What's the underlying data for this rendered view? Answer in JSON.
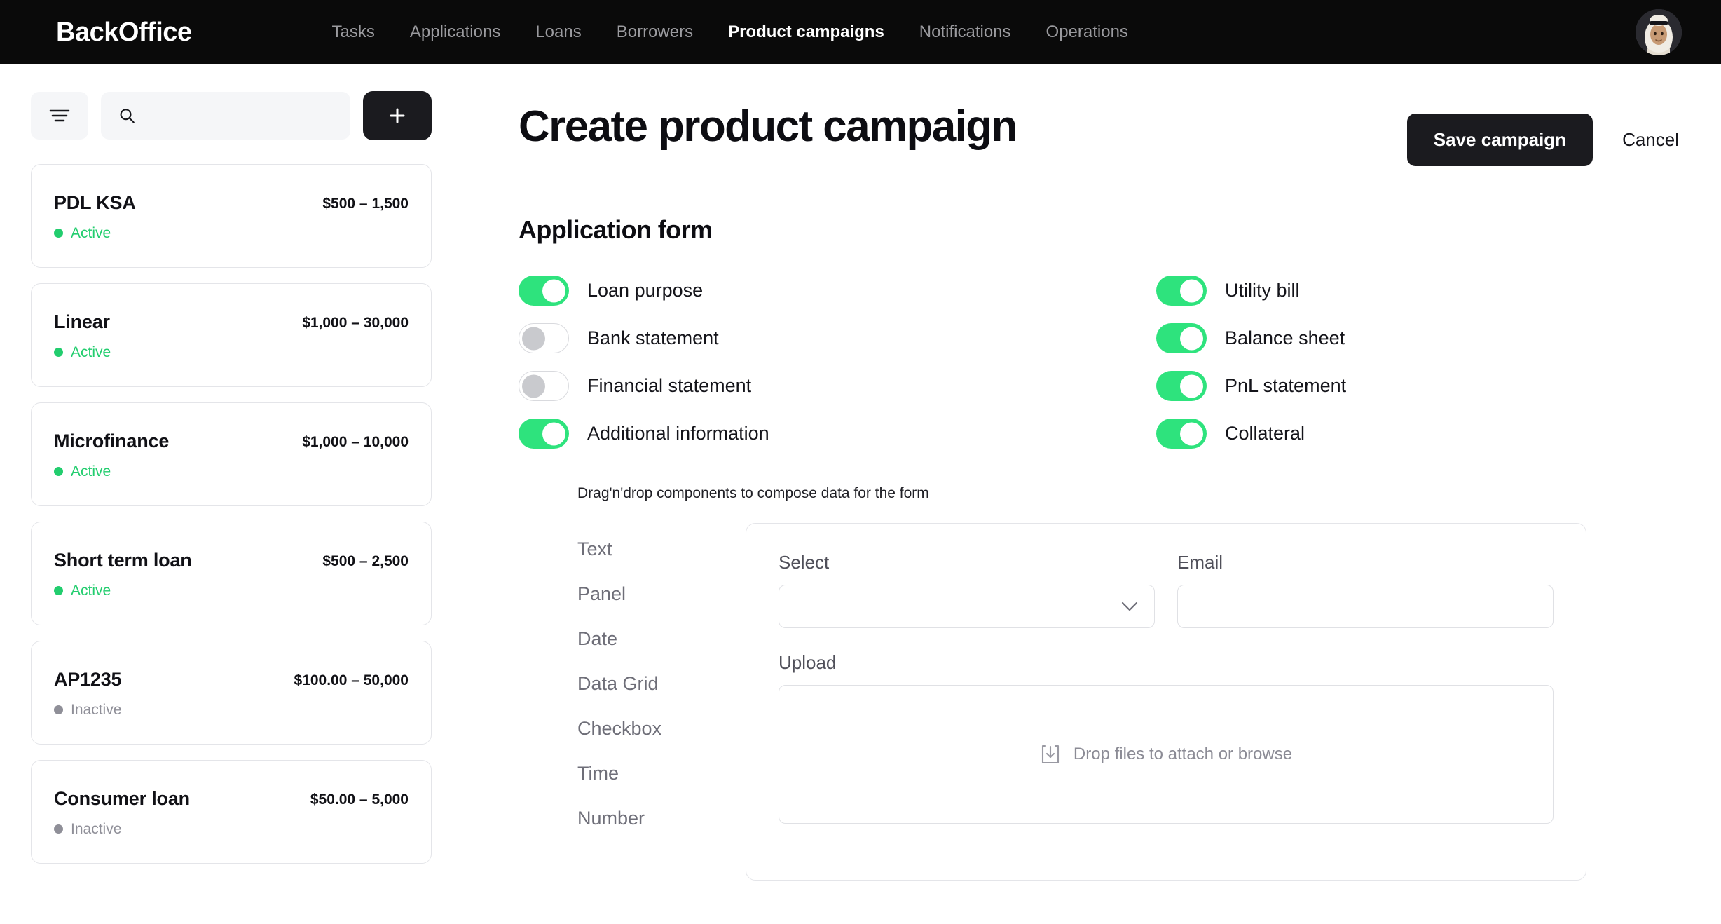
{
  "nav": {
    "brand": "BackOffice",
    "items": [
      {
        "label": "Tasks",
        "active": false
      },
      {
        "label": "Applications",
        "active": false
      },
      {
        "label": "Loans",
        "active": false
      },
      {
        "label": "Borrowers",
        "active": false
      },
      {
        "label": "Product campaigns",
        "active": true
      },
      {
        "label": "Notifications",
        "active": false
      },
      {
        "label": "Operations",
        "active": false
      }
    ],
    "avatar_icon": "user-avatar-photo"
  },
  "sidebar": {
    "filter_icon": "filter-icon",
    "search_icon": "search-icon",
    "search_value": "",
    "search_placeholder": "",
    "add_icon": "plus-icon",
    "campaigns": [
      {
        "name": "PDL KSA",
        "amount": "$500 – 1,500",
        "status": "Active",
        "state": "active"
      },
      {
        "name": "Linear",
        "amount": "$1,000 – 30,000",
        "status": "Active",
        "state": "active"
      },
      {
        "name": "Microfinance",
        "amount": "$1,000 – 10,000",
        "status": "Active",
        "state": "active"
      },
      {
        "name": "Short term loan",
        "amount": "$500 – 2,500",
        "status": "Active",
        "state": "active"
      },
      {
        "name": "AP1235",
        "amount": "$100.00 – 50,000",
        "status": "Inactive",
        "state": "inactive"
      },
      {
        "name": "Consumer loan",
        "amount": "$50.00 – 5,000",
        "status": "Inactive",
        "state": "inactive"
      }
    ]
  },
  "main": {
    "title": "Create product campaign",
    "save_label": "Save campaign",
    "cancel_label": "Cancel",
    "section_title": "Application form",
    "toggles": [
      {
        "label": "Loan purpose",
        "on": true
      },
      {
        "label": "Utility bill",
        "on": true
      },
      {
        "label": "Bank statement",
        "on": false
      },
      {
        "label": "Balance sheet",
        "on": true
      },
      {
        "label": "Financial statement",
        "on": false
      },
      {
        "label": "PnL statement",
        "on": true
      },
      {
        "label": "Additional information",
        "on": true
      },
      {
        "label": "Collateral",
        "on": true
      }
    ],
    "builder": {
      "hint": "Drag'n'drop components to compose data for the form",
      "palette": [
        "Text",
        "Panel",
        "Date",
        "Data Grid",
        "Checkbox",
        "Time",
        "Number"
      ],
      "fields": {
        "select_label": "Select",
        "select_value": "",
        "select_icon": "chevron-down-icon",
        "email_label": "Email",
        "email_value": "",
        "upload_label": "Upload",
        "upload_icon": "upload-tray-icon",
        "upload_text": "Drop files to attach or browse"
      }
    }
  },
  "colors": {
    "accent_green": "#2ee37d",
    "active_green": "#22cd6e",
    "inactive_gray": "#8f8f98",
    "dark": "#1b1b1f"
  }
}
